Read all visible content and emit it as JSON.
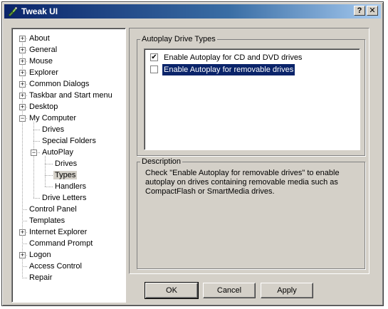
{
  "window": {
    "title": "Tweak UI",
    "help_button": "?",
    "close_button": "✕"
  },
  "tree": {
    "items": [
      {
        "label": "About",
        "expander": "+"
      },
      {
        "label": "General",
        "expander": "+"
      },
      {
        "label": "Mouse",
        "expander": "+"
      },
      {
        "label": "Explorer",
        "expander": "+"
      },
      {
        "label": "Common Dialogs",
        "expander": "+"
      },
      {
        "label": "Taskbar and Start menu",
        "expander": "+"
      },
      {
        "label": "Desktop",
        "expander": "+"
      },
      {
        "label": "My Computer",
        "expander": "−"
      },
      {
        "label": "Drives"
      },
      {
        "label": "Special Folders"
      },
      {
        "label": "AutoPlay",
        "expander": "−"
      },
      {
        "label": "Drives"
      },
      {
        "label": "Types",
        "selected": true
      },
      {
        "label": "Handlers"
      },
      {
        "label": "Drive Letters"
      },
      {
        "label": "Control Panel"
      },
      {
        "label": "Templates"
      },
      {
        "label": "Internet Explorer",
        "expander": "+"
      },
      {
        "label": "Command Prompt"
      },
      {
        "label": "Logon",
        "expander": "+"
      },
      {
        "label": "Access Control"
      },
      {
        "label": "Repair"
      }
    ]
  },
  "autoplay": {
    "group_label": "Autoplay Drive Types",
    "options": [
      {
        "label": "Enable Autoplay for CD and DVD drives",
        "checked": true
      },
      {
        "label": "Enable Autoplay for removable drives",
        "checked": false
      }
    ]
  },
  "description": {
    "group_label": "Description",
    "text": "Check \"Enable Autoplay for removable drives\" to enable autoplay on drives containing removable media such as CompactFlash or SmartMedia drives."
  },
  "buttons": {
    "ok": "OK",
    "cancel": "Cancel",
    "apply": "Apply"
  },
  "colors": {
    "titlebar": "#0a246a",
    "face": "#d4d0c8",
    "highlight": "#0a246a"
  }
}
